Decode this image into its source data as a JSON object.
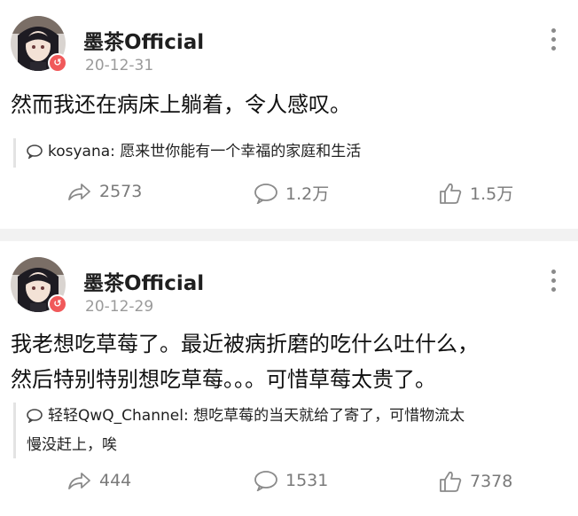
{
  "posts": [
    {
      "author": "墨茶Official",
      "date": "20-12-31",
      "avatar_badge": "↺",
      "content": "然而我还在病床上躺着，令人感叹。",
      "comment": {
        "user": "kosyana:",
        "text": "愿来世你能有一个幸福的家庭和生活"
      },
      "actions": {
        "repost": "2573",
        "comment": "1.2万",
        "like": "1.5万"
      }
    },
    {
      "author": "墨茶Official",
      "date": "20-12-29",
      "avatar_badge": "↺",
      "content_line1": "我老想吃草莓了。最近被病折磨的吃什么吐什么，",
      "content_line2": "然后特别特别想吃草莓。。。可惜草莓太贵了。",
      "comment": {
        "user": "轻轻QwQ_Channel:",
        "text_line1": "想吃草莓的当天就给了寄了，可惜物流太",
        "text_line2": "慢没赶上，唉"
      },
      "actions": {
        "repost": "444",
        "comment": "1531",
        "like": "7378"
      }
    }
  ],
  "icons": {
    "repost": "repost-icon",
    "comment": "comment-icon",
    "like": "like-icon",
    "more": "more-icon"
  },
  "colors": {
    "badge": "#f0595a",
    "muted": "#9a9a9a",
    "separator": "#f2f2f2"
  }
}
